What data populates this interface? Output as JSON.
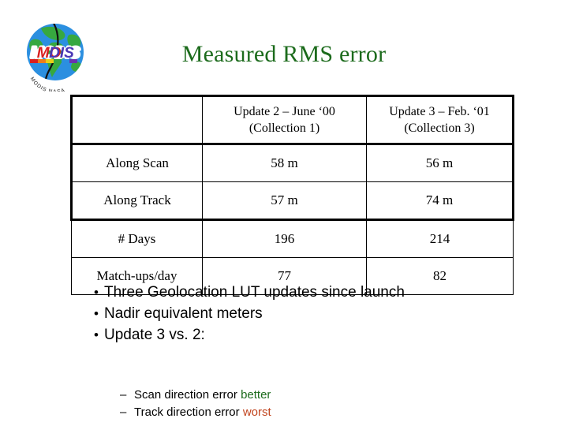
{
  "slide": {
    "title": "Measured RMS error",
    "title_color": "#1c6b1c",
    "background_color": "#ffffff"
  },
  "logo": {
    "name": "modis-logo",
    "wordmark": "MODIS",
    "arc_text": "MODIS / NASA",
    "globe_blue": "#1e7fd4",
    "globe_green": "#2fa83c"
  },
  "table": {
    "columns": [
      {
        "id": "label",
        "header_line1": "",
        "header_line2": ""
      },
      {
        "id": "update2",
        "header_line1": "Update 2 – June ‘00",
        "header_line2": "(Collection 1)"
      },
      {
        "id": "update3",
        "header_line1": "Update 3 – Feb. ‘01",
        "header_line2": "(Collection 3)"
      }
    ],
    "rows": [
      {
        "label": "Along Scan",
        "update2": "58 m",
        "update3": "56 m",
        "update3_color": "#1c6b1c"
      },
      {
        "label": "Along Track",
        "update2": "57 m",
        "update3": "74 m",
        "update3_color": "#c1451f"
      },
      {
        "label": "# Days",
        "update2": "196",
        "update3": "214",
        "update3_color": "#000000"
      },
      {
        "label": "Match-ups/day",
        "update2": "77",
        "update3": "82",
        "update3_color": "#000000"
      }
    ]
  },
  "bullets": {
    "marker": "•",
    "items": [
      "Three Geolocation LUT updates since launch",
      "Nadir equivalent meters",
      "Update 3 vs. 2:"
    ]
  },
  "subbullets": {
    "marker": "–",
    "items": [
      {
        "text": "Scan direction error ",
        "keyword": "better",
        "keyword_color": "#1c6b1c"
      },
      {
        "text": "Track direction error ",
        "keyword": "worst",
        "keyword_color": "#c1451f"
      }
    ]
  }
}
